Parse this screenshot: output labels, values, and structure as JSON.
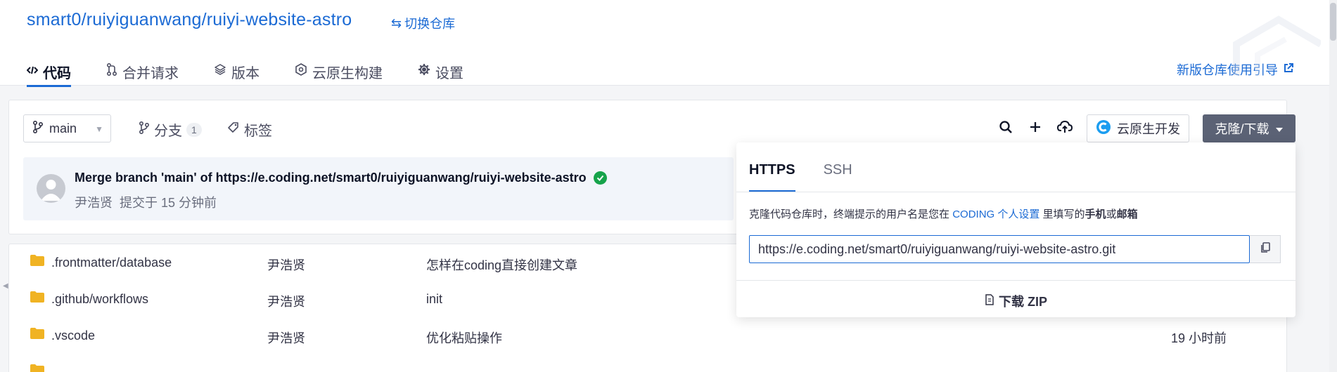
{
  "repo": {
    "title": "smart0/ruiyiguanwang/ruiyi-website-astro",
    "switch_label": "切换仓库"
  },
  "tabs": [
    {
      "label": "代码",
      "icon": "code-icon",
      "active": true
    },
    {
      "label": "合并请求",
      "icon": "merge-request-icon"
    },
    {
      "label": "版本",
      "icon": "layers-icon"
    },
    {
      "label": "云原生构建",
      "icon": "build-icon"
    },
    {
      "label": "设置",
      "icon": "gear-icon"
    }
  ],
  "guide_link": "新版仓库使用引导",
  "toolbar": {
    "branch": "main",
    "branches_label": "分支",
    "branches_count": "1",
    "tags_label": "标签",
    "cloud_dev_label": "云原生开发",
    "clone_label": "克隆/下载"
  },
  "commit": {
    "message": "Merge branch 'main' of https://e.coding.net/smart0/ruiyiguanwang/ruiyi-website-astro",
    "author": "尹浩贤",
    "time": "提交于 15 分钟前"
  },
  "files": [
    {
      "name": ".frontmatter/database",
      "author": "尹浩贤",
      "message": "怎样在coding直接创建文章",
      "time": ""
    },
    {
      "name": ".github/workflows",
      "author": "尹浩贤",
      "message": "init",
      "time": ""
    },
    {
      "name": ".vscode",
      "author": "尹浩贤",
      "message": "优化粘贴操作",
      "time": "19 小时前"
    }
  ],
  "clone_popup": {
    "tabs": [
      "HTTPS",
      "SSH"
    ],
    "active_tab": "HTTPS",
    "hint_before": "克隆代码仓库时，终端提示的用户名是您在",
    "hint_link": "CODING 个人设置",
    "hint_middle": "里填写的",
    "hint_bold_1": "手机",
    "hint_or": "或",
    "hint_bold_2": "邮箱",
    "url": "https://e.coding.net/smart0/ruiyiguanwang/ruiyi-website-astro.git",
    "download_zip": "下载 ZIP"
  },
  "colors": {
    "accent": "#1b6ad4",
    "clone_button": "#5b6275",
    "success": "#16a34a",
    "folder": "#f0b323"
  }
}
